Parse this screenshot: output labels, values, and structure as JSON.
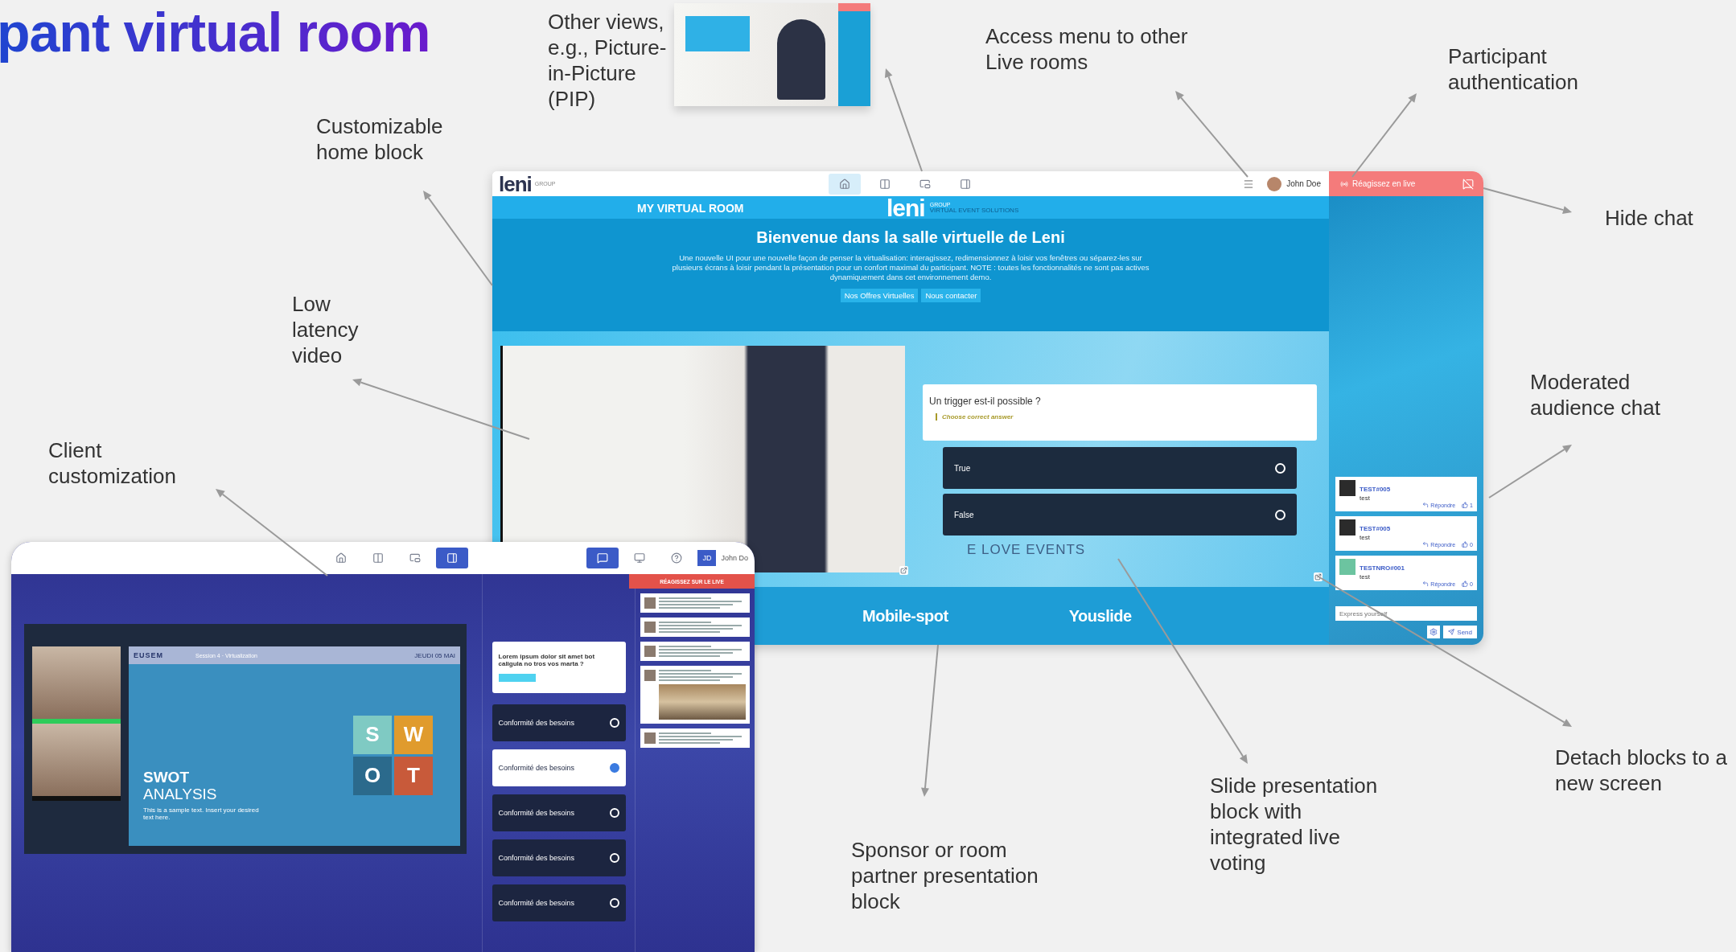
{
  "heading": "pant virtual room",
  "callouts": [
    {
      "text": "Other views, e.g., Picture-in-Picture (PIP)"
    },
    {
      "text": "Access menu to other Live rooms"
    },
    {
      "text": "Participant authentication"
    },
    {
      "text": "Customizable home block"
    },
    {
      "text": "Hide chat"
    },
    {
      "text": "Low latency video"
    },
    {
      "text": "Moderated audience chat"
    },
    {
      "text": "Client customization"
    },
    {
      "text": "Detach blocks to a new screen"
    },
    {
      "text": "Slide presentation block with integrated live voting"
    },
    {
      "text": "Sponsor or room partner presentation block"
    }
  ],
  "main_window": {
    "logo": {
      "word": "leni",
      "sub": "GROUP"
    },
    "view_tabs": [
      {
        "kind": "home",
        "selected": true
      },
      {
        "kind": "split",
        "selected": false
      },
      {
        "kind": "pip",
        "selected": false
      },
      {
        "kind": "sidebar",
        "selected": false
      }
    ],
    "user": "John Doe",
    "auth_button": "Réagissez en live",
    "room_title": "MY VIRTUAL ROOM",
    "brand": {
      "word": "leni",
      "sub": "GROUP",
      "tagline": "VIRTUAL EVENT SOLUTIONS"
    },
    "welcome_title": "Bienvenue dans la salle virtuelle de Leni",
    "welcome_text": "Une nouvelle UI pour une nouvelle façon de penser la virtualisation: interagissez, redimensionnez à loisir vos fenêtres ou séparez-les sur plusieurs écrans à loisir pendant la présentation pour un confort maximal du participant. NOTE : toutes les fonctionnalités ne sont pas actives dynamiquement dans cet environnement demo.",
    "links": [
      "Nos Offres Virtuelles",
      "Nous contacter"
    ],
    "poll": {
      "question": "Un trigger est-il possible ?",
      "hint": "Choose correct answer",
      "options": [
        {
          "label": "True",
          "selected": false
        },
        {
          "label": "False",
          "selected": false
        }
      ]
    },
    "backdrop_text": "E LOVE EVENTS",
    "sponsors": [
      "Mobile-spot",
      "Youslide"
    ],
    "chat": {
      "messages": [
        {
          "author": "TEST#005",
          "text": "test",
          "reply": "Répondre",
          "likes": "1",
          "color": "#2b2b2b"
        },
        {
          "author": "TEST#005",
          "text": "test",
          "reply": "Répondre",
          "likes": "0",
          "color": "#2b2b2b"
        },
        {
          "author": "TESTNRO#001",
          "text": "test",
          "reply": "Répondre",
          "likes": "0",
          "color": "#6cc4a0"
        }
      ],
      "placeholder": "Express yourself",
      "send": "Send"
    }
  },
  "client_window": {
    "view_tabs": [
      {
        "kind": "home",
        "selected": false
      },
      {
        "kind": "split",
        "selected": false
      },
      {
        "kind": "pip",
        "selected": false
      },
      {
        "kind": "sidebar",
        "selected": true
      }
    ],
    "panel_tabs": [
      {
        "kind": "chat",
        "selected": true
      },
      {
        "kind": "screen",
        "selected": false
      },
      {
        "kind": "help",
        "selected": false
      }
    ],
    "user_initials": "JD",
    "user": "John Do",
    "live_banner": "RÉAGISSEZ SUR LE LIVE",
    "speakers": [
      {
        "speaking": true
      },
      {
        "speaking": false
      }
    ],
    "slide": {
      "brand": "EUSEM",
      "session": "Session 4 · Virtualization",
      "date": "JEUDI 05 MAI",
      "title": "SWOT",
      "subtitle": "ANALYSIS",
      "body": "This is a sample text. Insert your desired text here.",
      "tiles": [
        {
          "letter": "S",
          "color": "#7fcac3"
        },
        {
          "letter": "W",
          "color": "#e09b2d"
        },
        {
          "letter": "O",
          "color": "#2b6a8c"
        },
        {
          "letter": "T",
          "color": "#c85a3a"
        }
      ]
    },
    "question": "Lorem ipsum dolor sit amet bot caligula no tros vos marta ?",
    "options": [
      {
        "label": "Conformité des besoins",
        "selected": false
      },
      {
        "label": "Conformité des besoins",
        "selected": true
      },
      {
        "label": "Conformité des besoins",
        "selected": false
      },
      {
        "label": "Conformité des besoins",
        "selected": false
      },
      {
        "label": "Conformité des besoins",
        "selected": false
      }
    ],
    "chat_cards": [
      {
        "kind": "text"
      },
      {
        "kind": "text"
      },
      {
        "kind": "text"
      },
      {
        "kind": "image"
      },
      {
        "kind": "text"
      }
    ]
  }
}
